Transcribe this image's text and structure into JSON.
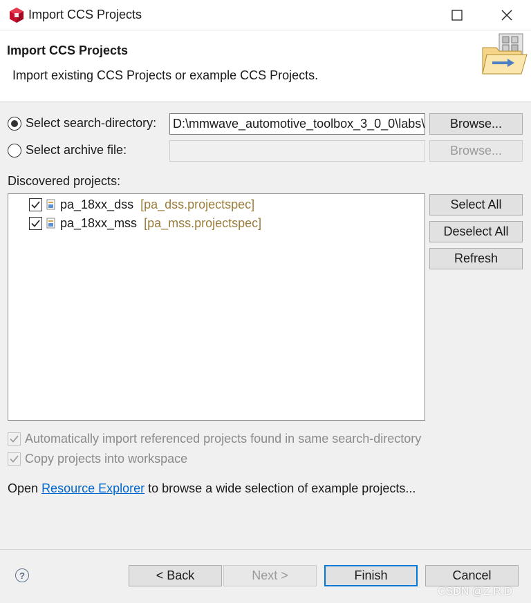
{
  "window": {
    "title": "Import CCS Projects",
    "maximize_icon": "maximize-icon",
    "close_icon": "close-icon"
  },
  "header": {
    "title": "Import CCS Projects",
    "description": "Import existing CCS Projects or example CCS Projects."
  },
  "source": {
    "search_directory_label": "Select search-directory:",
    "search_directory_value": "D:\\mmwave_automotive_toolbox_3_0_0\\labs\\",
    "search_directory_selected": true,
    "archive_label": "Select archive file:",
    "archive_value": "",
    "archive_selected": false,
    "browse_label": "Browse...",
    "browse_archive_label": "Browse..."
  },
  "discovered": {
    "label": "Discovered projects:",
    "projects": [
      {
        "name": "pa_18xx_dss",
        "spec": "[pa_dss.projectspec]",
        "checked": true
      },
      {
        "name": "pa_18xx_mss",
        "spec": "[pa_mss.projectspec]",
        "checked": true
      }
    ],
    "select_all": "Select All",
    "deselect_all": "Deselect All",
    "refresh": "Refresh"
  },
  "options": {
    "auto_import": "Automatically import referenced projects found in same search-directory",
    "copy_projects": "Copy projects into workspace"
  },
  "resource_line": {
    "prefix": "Open",
    "link": "Resource Explorer",
    "suffix": "to browse a wide selection of example projects..."
  },
  "footer": {
    "help_icon": "help-icon",
    "help_glyph": "?",
    "back": "< Back",
    "next": "Next >",
    "finish": "Finish",
    "cancel": "Cancel"
  },
  "watermark": "CSDN @Z.R.D",
  "colors": {
    "link": "#0066cc",
    "projectspec": "#9b7d3c",
    "default_button_border": "#0078d7"
  }
}
